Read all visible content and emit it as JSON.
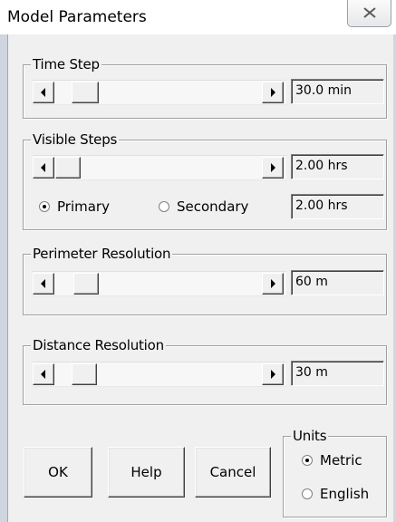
{
  "window": {
    "title": "Model Parameters"
  },
  "time_step": {
    "label": "Time Step",
    "value": "30.0 min",
    "thumb_position": 0.08
  },
  "visible_steps": {
    "label": "Visible Steps",
    "value": "2.00 hrs",
    "thumb_position": 0.0,
    "radio_primary": "Primary",
    "radio_secondary": "Secondary",
    "selected": "Primary",
    "secondary_value": "2.00 hrs"
  },
  "perimeter_resolution": {
    "label": "Perimeter Resolution",
    "value": "60 m",
    "thumb_position": 0.08
  },
  "distance_resolution": {
    "label": "Distance Resolution",
    "value": "30 m",
    "thumb_position": 0.08
  },
  "buttons": {
    "ok": "OK",
    "help": "Help",
    "cancel": "Cancel"
  },
  "units": {
    "label": "Units",
    "metric": "Metric",
    "english": "English",
    "selected": "Metric"
  }
}
